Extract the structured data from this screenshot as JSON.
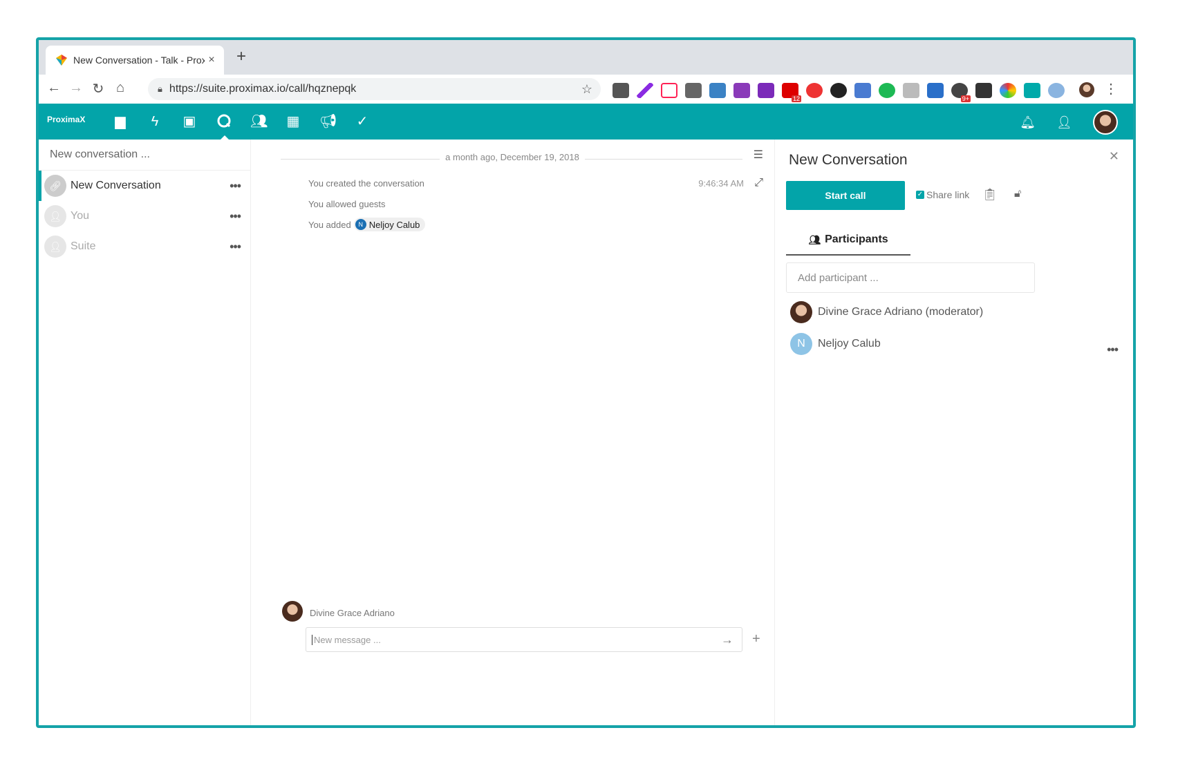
{
  "browser": {
    "tab_title": "New Conversation - Talk - Prox",
    "url": "https://suite.proximax.io/call/hqznepqk",
    "new_tab": "+",
    "close_tab": "×"
  },
  "app": {
    "logo": "ProximaX",
    "nav_icons": [
      "files-icon",
      "activity-icon",
      "gallery-icon",
      "talk-icon",
      "contacts-icon",
      "calendar-icon",
      "announcements-icon",
      "tasks-icon"
    ]
  },
  "sidebar": {
    "search_placeholder": "New conversation ...",
    "conversations": [
      {
        "name": "New Conversation",
        "more": "•••"
      },
      {
        "name": "You",
        "more": "•••"
      },
      {
        "name": "Suite",
        "more": "•••"
      }
    ]
  },
  "chat": {
    "date_separator": "a month ago, December 19, 2018",
    "messages": [
      "You created the conversation",
      "You allowed guests",
      "You added"
    ],
    "mention": {
      "initial": "N",
      "name": "Neljoy Calub"
    },
    "time": "9:46:34 AM",
    "composer_author": "Divine Grace Adriano",
    "composer_placeholder": "New message ..."
  },
  "panel": {
    "title": "New Conversation",
    "start_call": "Start call",
    "share_link": "Share link",
    "participants_tab": "Participants",
    "add_participant_placeholder": "Add participant ...",
    "participants": [
      {
        "name": "Divine Grace Adriano (moderator)"
      },
      {
        "name": "Neljoy Calub",
        "initial": "N",
        "more": "•••"
      }
    ]
  },
  "colors": {
    "accent": "#03a4a9",
    "frame": "#15a3a8"
  }
}
